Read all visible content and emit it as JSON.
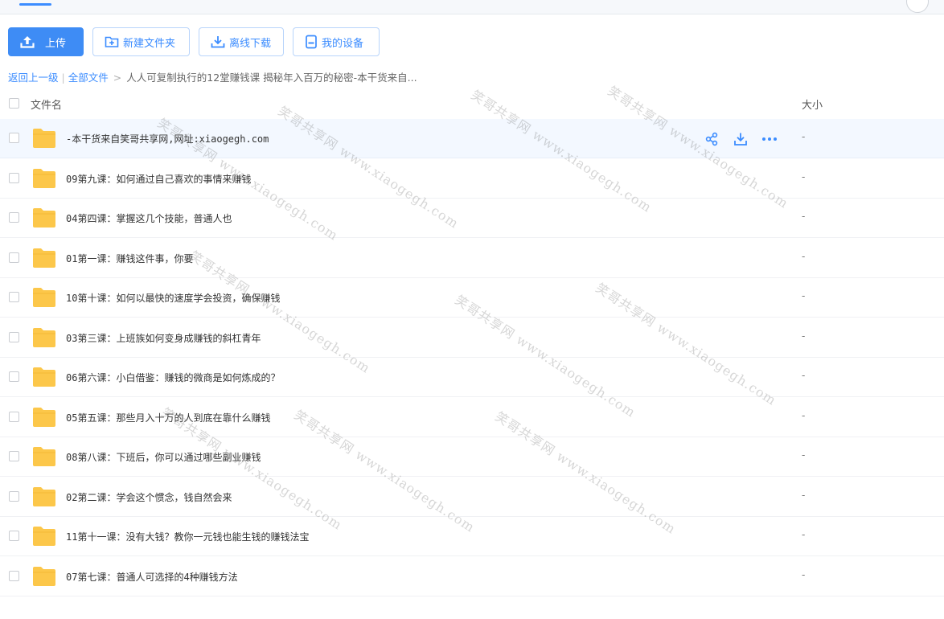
{
  "toolbar": {
    "upload": "上传",
    "new_folder": "新建文件夹",
    "offline_download": "离线下载",
    "my_devices": "我的设备"
  },
  "breadcrumb": {
    "back": "返回上一级",
    "all_files": "全部文件",
    "current": "人人可复制执行的12堂赚钱课 揭秘年入百万的秘密-本干货来自..."
  },
  "table": {
    "col_name": "文件名",
    "col_size": "大小",
    "rows": [
      {
        "name": "-本干货来自笑哥共享网,网址:xiaogegh.com",
        "size": "-"
      },
      {
        "name": "09第九课：如何通过自己喜欢的事情来赚钱",
        "size": "-"
      },
      {
        "name": "04第四课：掌握这几个技能，普通人也",
        "size": "-"
      },
      {
        "name": "01第一课：赚钱这件事，你要",
        "size": "-"
      },
      {
        "name": "10第十课：如何以最快的速度学会投资，确保赚钱",
        "size": "-"
      },
      {
        "name": "03第三课：上班族如何变身成赚钱的斜杠青年",
        "size": "-"
      },
      {
        "name": "06第六课：小白借鉴：赚钱的微商是如何炼成的？",
        "size": "-"
      },
      {
        "name": "05第五课：那些月入十万的人到底在靠什么赚钱",
        "size": "-"
      },
      {
        "name": "08第八课：下班后，你可以通过哪些副业赚钱",
        "size": "-"
      },
      {
        "name": "02第二课：学会这个惯念，钱自然会来",
        "size": "-"
      },
      {
        "name": "11第十一课：没有大钱？教你一元钱也能生钱的赚钱法宝",
        "size": "-"
      },
      {
        "name": "07第七课：普通人可选择的4种赚钱方法",
        "size": "-"
      }
    ]
  },
  "watermark": "笑哥共享网 www.xiaogegh.com",
  "colors": {
    "accent": "#3e8cf5",
    "folder": "#fcc74a",
    "hover_row": "#f3f8ff"
  }
}
